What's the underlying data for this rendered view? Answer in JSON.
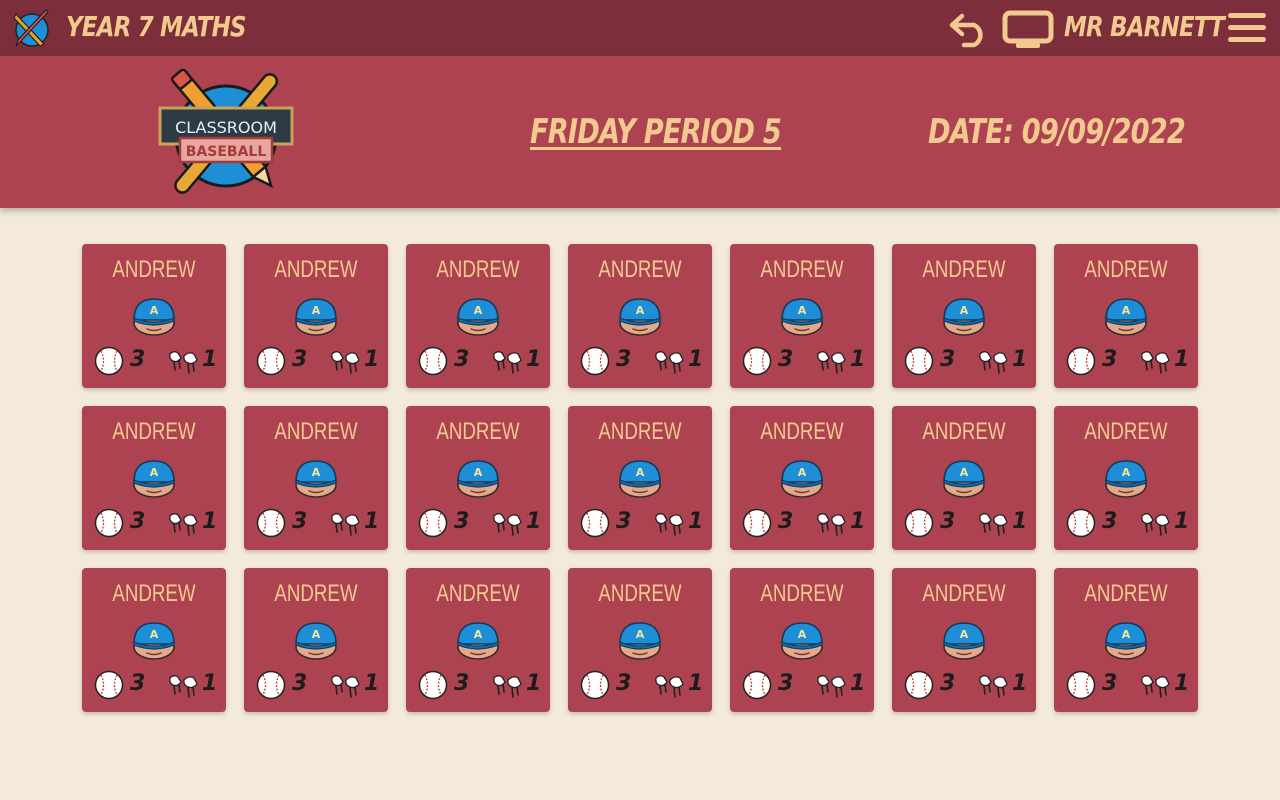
{
  "topbar": {
    "app_title": "Year 7 Maths",
    "teacher_name": "Mr Barnett"
  },
  "header": {
    "logo_text_top": "CLASSROOM",
    "logo_text_bottom": "BASEBALL",
    "period_title": "Friday Period 5",
    "date_label": "Date: 09/09/2022"
  },
  "icons": {
    "app": "baseball-bat-pencil-icon",
    "undo": "undo-icon",
    "screen": "screen-icon",
    "menu": "hamburger-menu-icon",
    "avatar": "player-cap-avatar-icon",
    "ball": "baseball-icon",
    "cleats": "cleats-icon"
  },
  "colors": {
    "topbar": "#7c2f3a",
    "header": "#ad4350",
    "card": "#ad4350",
    "accent_text": "#f2c98f",
    "background": "#f3ead9",
    "cap": "#1e8fd6"
  },
  "students": [
    {
      "name": "ANDREW",
      "cap_letter": "A",
      "balls": "3",
      "cleats": "1"
    },
    {
      "name": "ANDREW",
      "cap_letter": "A",
      "balls": "3",
      "cleats": "1"
    },
    {
      "name": "ANDREW",
      "cap_letter": "A",
      "balls": "3",
      "cleats": "1"
    },
    {
      "name": "ANDREW",
      "cap_letter": "A",
      "balls": "3",
      "cleats": "1"
    },
    {
      "name": "ANDREW",
      "cap_letter": "A",
      "balls": "3",
      "cleats": "1"
    },
    {
      "name": "ANDREW",
      "cap_letter": "A",
      "balls": "3",
      "cleats": "1"
    },
    {
      "name": "ANDREW",
      "cap_letter": "A",
      "balls": "3",
      "cleats": "1"
    },
    {
      "name": "ANDREW",
      "cap_letter": "A",
      "balls": "3",
      "cleats": "1"
    },
    {
      "name": "ANDREW",
      "cap_letter": "A",
      "balls": "3",
      "cleats": "1"
    },
    {
      "name": "ANDREW",
      "cap_letter": "A",
      "balls": "3",
      "cleats": "1"
    },
    {
      "name": "ANDREW",
      "cap_letter": "A",
      "balls": "3",
      "cleats": "1"
    },
    {
      "name": "ANDREW",
      "cap_letter": "A",
      "balls": "3",
      "cleats": "1"
    },
    {
      "name": "ANDREW",
      "cap_letter": "A",
      "balls": "3",
      "cleats": "1"
    },
    {
      "name": "ANDREW",
      "cap_letter": "A",
      "balls": "3",
      "cleats": "1"
    },
    {
      "name": "ANDREW",
      "cap_letter": "A",
      "balls": "3",
      "cleats": "1"
    },
    {
      "name": "ANDREW",
      "cap_letter": "A",
      "balls": "3",
      "cleats": "1"
    },
    {
      "name": "ANDREW",
      "cap_letter": "A",
      "balls": "3",
      "cleats": "1"
    },
    {
      "name": "ANDREW",
      "cap_letter": "A",
      "balls": "3",
      "cleats": "1"
    },
    {
      "name": "ANDREW",
      "cap_letter": "A",
      "balls": "3",
      "cleats": "1"
    },
    {
      "name": "ANDREW",
      "cap_letter": "A",
      "balls": "3",
      "cleats": "1"
    },
    {
      "name": "ANDREW",
      "cap_letter": "A",
      "balls": "3",
      "cleats": "1"
    }
  ]
}
